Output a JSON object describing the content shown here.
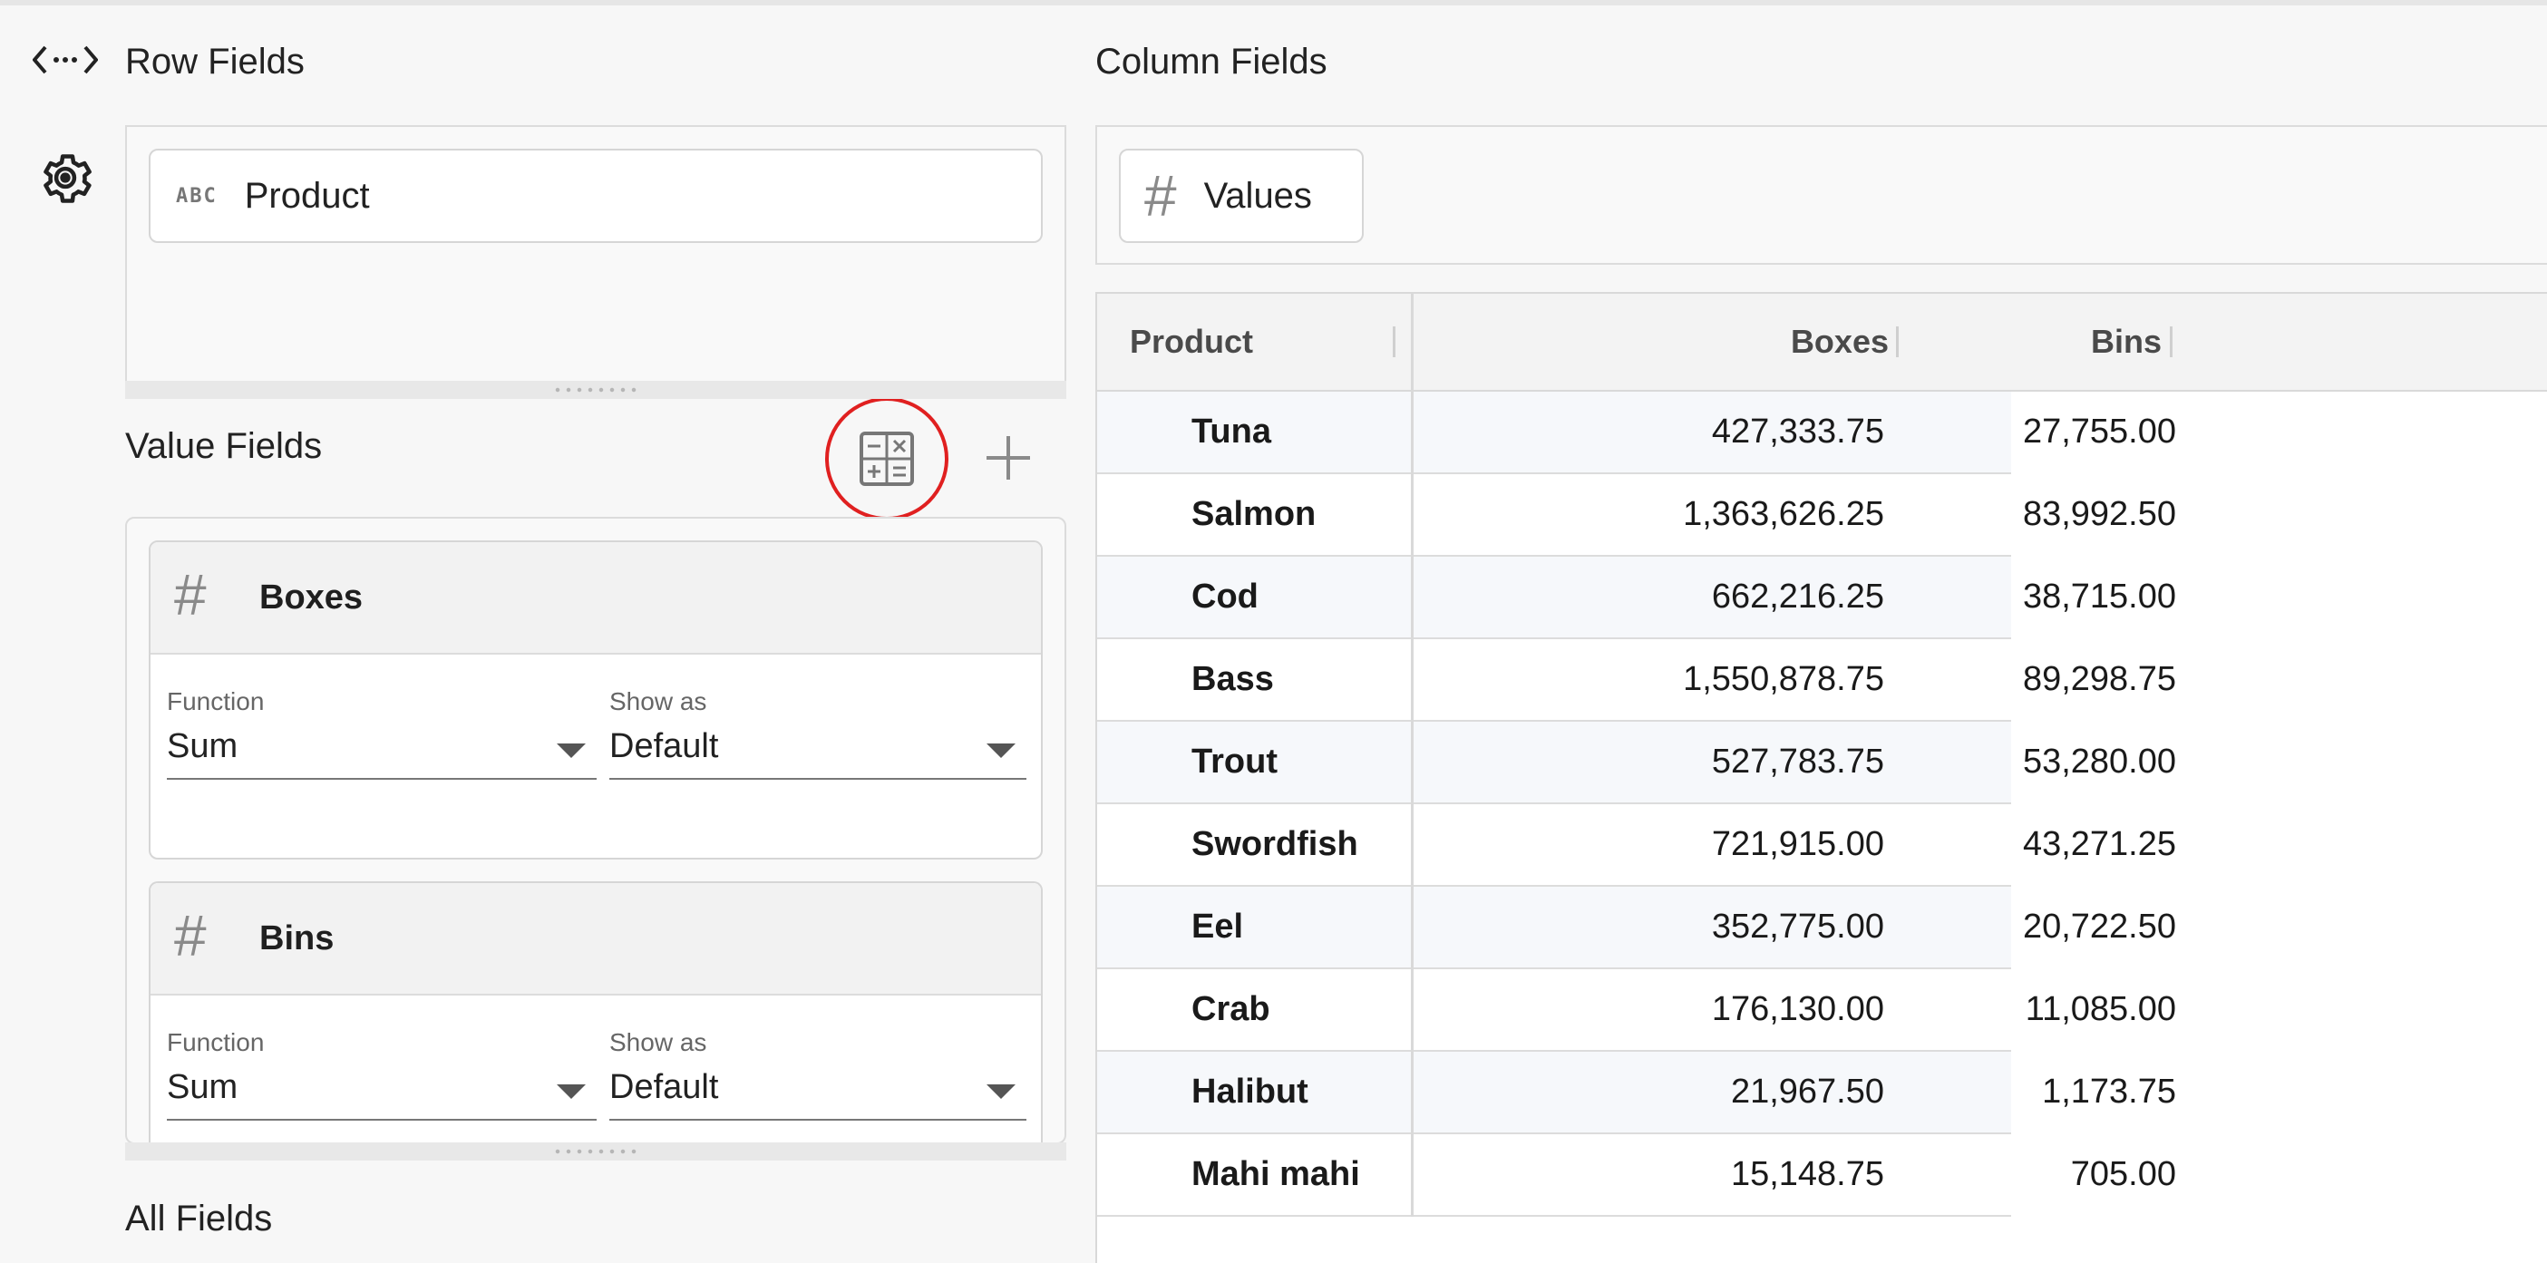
{
  "panels": {
    "row_fields": {
      "title": "Row Fields",
      "chip": {
        "type_label": "ABC",
        "label": "Product"
      }
    },
    "column_fields": {
      "title": "Column Fields",
      "chip": {
        "type_label": "#",
        "label": "Values"
      }
    },
    "value_fields": {
      "title": "Value Fields",
      "items": [
        {
          "name": "Boxes",
          "type_label": "#",
          "function_label": "Function",
          "function_value": "Sum",
          "show_as_label": "Show as",
          "show_as_value": "Default"
        },
        {
          "name": "Bins",
          "type_label": "#",
          "function_label": "Function",
          "function_value": "Sum",
          "show_as_label": "Show as",
          "show_as_value": "Default"
        }
      ]
    },
    "all_fields": {
      "title": "All Fields"
    }
  },
  "icons": {
    "code": "code-icon",
    "settings": "gear-icon",
    "calculator": "calculator-icon",
    "add": "plus-icon",
    "highlight_color": "#e02020"
  },
  "table": {
    "headers": [
      "Product",
      "Boxes",
      "Bins"
    ],
    "rows": [
      {
        "product": "Tuna",
        "boxes": "427,333.75",
        "bins": "27,755.00"
      },
      {
        "product": "Salmon",
        "boxes": "1,363,626.25",
        "bins": "83,992.50"
      },
      {
        "product": "Cod",
        "boxes": "662,216.25",
        "bins": "38,715.00"
      },
      {
        "product": "Bass",
        "boxes": "1,550,878.75",
        "bins": "89,298.75"
      },
      {
        "product": "Trout",
        "boxes": "527,783.75",
        "bins": "53,280.00"
      },
      {
        "product": "Swordfish",
        "boxes": "721,915.00",
        "bins": "43,271.25"
      },
      {
        "product": "Eel",
        "boxes": "352,775.00",
        "bins": "20,722.50"
      },
      {
        "product": "Crab",
        "boxes": "176,130.00",
        "bins": "11,085.00"
      },
      {
        "product": "Halibut",
        "boxes": "21,967.50",
        "bins": "1,173.75"
      },
      {
        "product": "Mahi mahi",
        "boxes": "15,148.75",
        "bins": "705.00"
      }
    ]
  }
}
